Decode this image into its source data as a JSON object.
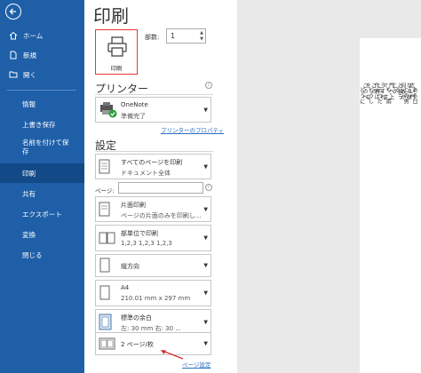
{
  "sidebar": {
    "items": [
      {
        "label": "ホーム"
      },
      {
        "label": "新規"
      },
      {
        "label": "開く"
      },
      {
        "label": "情報"
      },
      {
        "label": "上書き保存"
      },
      {
        "label": "名前を付けて保存"
      },
      {
        "label": "印刷"
      },
      {
        "label": "共有"
      },
      {
        "label": "エクスポート"
      },
      {
        "label": "変換"
      },
      {
        "label": "閉じる"
      }
    ]
  },
  "main": {
    "title": "印刷",
    "print_button": "印刷",
    "copies_label": "部数:",
    "copies_value": "1"
  },
  "printer": {
    "heading": "プリンター",
    "name": "OneNote",
    "status": "準備完了",
    "properties_link": "プリンターのプロパティ"
  },
  "settings": {
    "heading": "設定",
    "range": {
      "l1": "すべてのページを印刷",
      "l2": "ドキュメント全体"
    },
    "pages_label": "ページ:",
    "sides": {
      "l1": "片面印刷",
      "l2": "ページの片面のみを印刷し..."
    },
    "collate": {
      "l1": "部単位で印刷",
      "l2": "1,2,3    1,2,3    1,2,3"
    },
    "orientation": {
      "l1": "縦方向"
    },
    "paper": {
      "l1": "A4",
      "l2": "210.01 mm x 297 mm"
    },
    "margins": {
      "l1": "標準の余白",
      "l2": "左:  30 mm   右:  30 ..."
    },
    "per_sheet": {
      "l1": "2 ページ/枚"
    },
    "page_setup_link": "ページ設定"
  },
  "preview": {
    "columns": [
      "ある日",
      "広い門",
      "なるほ",
      "この男",
      "何故か",
      "と云う",
      "る。",
      "こう",
      "門へ上",
      "も、雨",
      "て、主",
      "うすれ",
      "云った",
      "作者は",
      "この",
      "どうし",
      "を、な",
      "このへ",
      "どうに"
    ]
  }
}
